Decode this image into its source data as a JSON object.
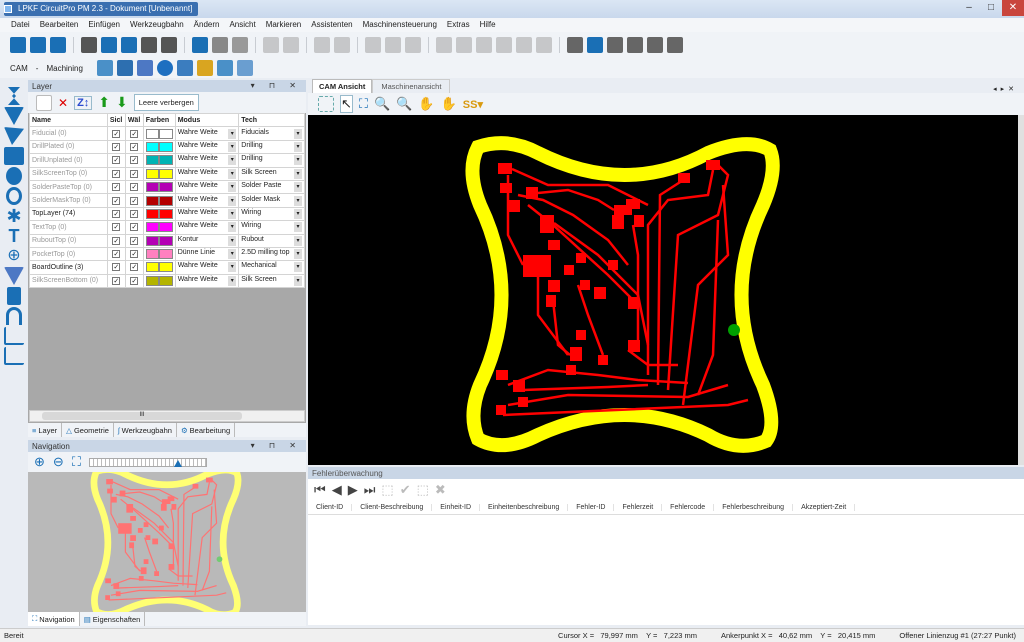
{
  "window": {
    "title": "LPKF CircuitPro PM 2.3 - Dokument [Unbenannt]"
  },
  "menu": [
    "Datei",
    "Bearbeiten",
    "Einfügen",
    "Werkzeugbahn",
    "Ändern",
    "Ansicht",
    "Markieren",
    "Assistenten",
    "Maschinensteuerung",
    "Extras",
    "Hilfe"
  ],
  "toolbar2": {
    "mode": "CAM",
    "mode_sep": "-",
    "machining": "Machining"
  },
  "layer_panel": {
    "title": "Layer",
    "hide_empty": "Leere verbergen",
    "columns": [
      "Name",
      "Sicl",
      "Wäl",
      "Farben",
      "Modus",
      "Tech"
    ],
    "rows": [
      {
        "name": "Fiducial (0)",
        "active": false,
        "visible": true,
        "selectable": true,
        "color": "#ffffff",
        "mode": "Wahre Weite",
        "tech": "Fiducials"
      },
      {
        "name": "DrillPlated (0)",
        "active": false,
        "visible": true,
        "selectable": true,
        "color": "#00ffff",
        "mode": "Wahre Weite",
        "tech": "Drilling"
      },
      {
        "name": "DrillUnplated (0)",
        "active": false,
        "visible": true,
        "selectable": true,
        "color": "#00b4b4",
        "mode": "Wahre Weite",
        "tech": "Drilling"
      },
      {
        "name": "SilkScreenTop (0)",
        "active": false,
        "visible": true,
        "selectable": true,
        "color": "#ffff00",
        "mode": "Wahre Weite",
        "tech": "Silk Screen"
      },
      {
        "name": "SolderPasteTop (0)",
        "active": false,
        "visible": true,
        "selectable": true,
        "color": "#b400b4",
        "mode": "Wahre Weite",
        "tech": "Solder Paste"
      },
      {
        "name": "SolderMaskTop (0)",
        "active": false,
        "visible": true,
        "selectable": true,
        "color": "#b40000",
        "mode": "Wahre Weite",
        "tech": "Solder Mask"
      },
      {
        "name": "TopLayer (74)",
        "active": true,
        "visible": true,
        "selectable": true,
        "color": "#ff0000",
        "mode": "Wahre Weite",
        "tech": "Wiring"
      },
      {
        "name": "TextTop (0)",
        "active": false,
        "visible": true,
        "selectable": true,
        "color": "#ff00ff",
        "mode": "Wahre Weite",
        "tech": "Wiring"
      },
      {
        "name": "RuboutTop (0)",
        "active": false,
        "visible": true,
        "selectable": true,
        "color": "#b400b4",
        "mode": "Kontur",
        "tech": "Rubout"
      },
      {
        "name": "PocketTop (0)",
        "active": false,
        "visible": true,
        "selectable": true,
        "color": "#ff80c0",
        "mode": "Dünne Linie",
        "tech": "2.5D milling top"
      },
      {
        "name": "BoardOutline (3)",
        "active": true,
        "visible": true,
        "selectable": true,
        "color": "#ffff00",
        "mode": "Wahre Weite",
        "tech": "Mechanical"
      },
      {
        "name": "SilkScreenBottom (0)",
        "active": false,
        "visible": true,
        "selectable": true,
        "color": "#b4b400",
        "mode": "Wahre Weite",
        "tech": "Silk Screen"
      }
    ],
    "scroll_thumb": "III",
    "tabs": [
      "Layer",
      "Geometrie",
      "Werkzeugbahn",
      "Bearbeitung"
    ]
  },
  "navigation": {
    "title": "Navigation",
    "zoom_level": 0.75,
    "tabs": [
      "Navigation",
      "Eigenschaften"
    ]
  },
  "view": {
    "tabs": [
      "CAM Ansicht",
      "Maschinenansicht"
    ],
    "active_tab": 0
  },
  "errors": {
    "title": "Fehlerüberwachung",
    "columns": [
      "Client-ID",
      "Client-Beschreibung",
      "Einheit-ID",
      "Einheitenbeschreibung",
      "Fehler-ID",
      "Fehlerzeit",
      "Fehlercode",
      "Fehlerbeschreibung",
      "Akzeptiert-Zeit"
    ]
  },
  "status": {
    "ready": "Bereit",
    "cursor": "Cursor X =   79,997 mm    Y =   7,223 mm",
    "anchor": "Ankerpunkt X =   40,62 mm    Y =   20,415 mm",
    "info": "Offener Linienzug #1 (27:27 Punkt)"
  },
  "colors": {
    "board_outline": "#ffff00",
    "top_layer": "#ff0000",
    "canvas": "#000000",
    "marker": "#00a000"
  }
}
